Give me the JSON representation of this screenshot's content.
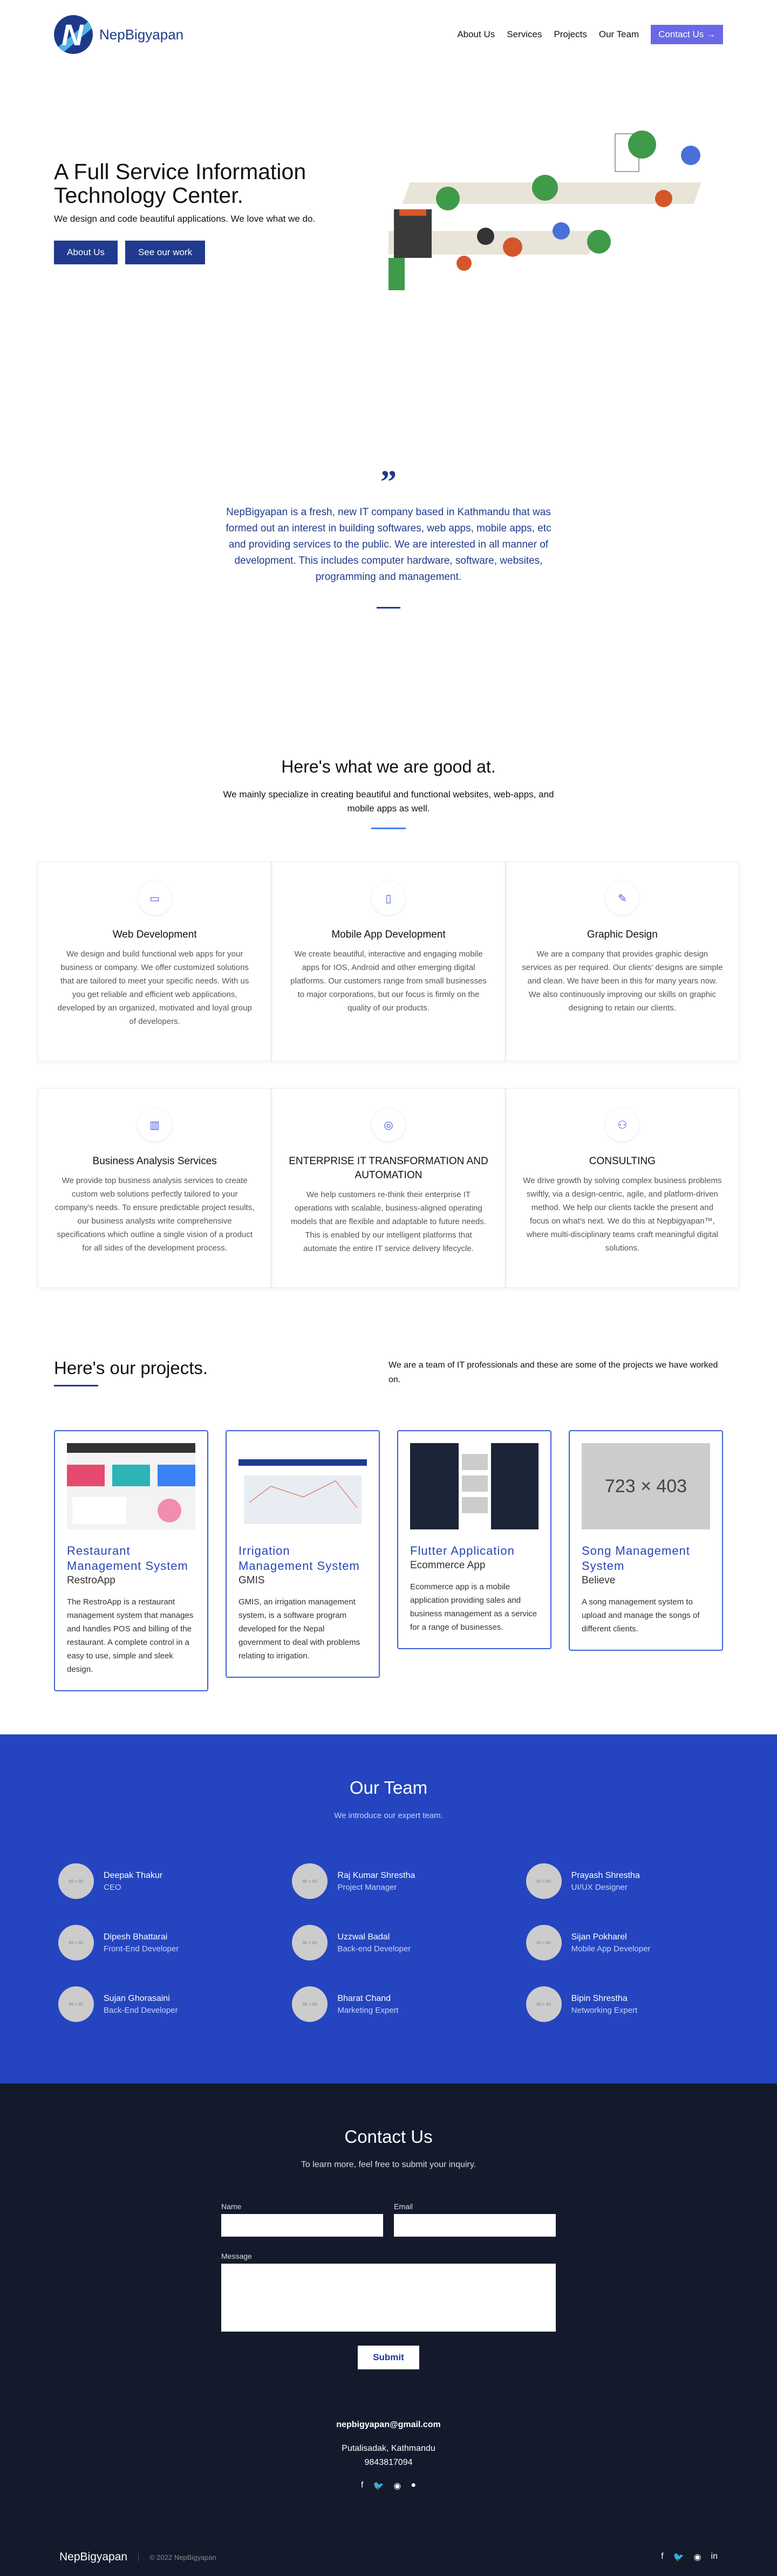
{
  "brand": {
    "name": "NepBigyapan",
    "logo_letter": "N"
  },
  "nav": {
    "links": [
      "About Us",
      "Services",
      "Projects",
      "Our Team"
    ],
    "cta": "Contact Us →"
  },
  "hero": {
    "title": "A Full Service Information Technology Center.",
    "subtitle": "We design and code beautiful applications. We love what we do.",
    "btn1": "About Us",
    "btn2": "See our work"
  },
  "about": {
    "quote_mark": "”",
    "text": "NepBigyapan is a fresh, new IT company based in Kathmandu that was formed out an interest in building softwares, web apps, mobile apps, etc and providing services to the public. We are interested in all manner of development. This includes computer hardware, software, websites, programming and management."
  },
  "services": {
    "title": "Here's what we are good at.",
    "subtitle": "We mainly specialize in creating beautiful and functional websites, web-apps, and mobile apps as well.",
    "items": [
      {
        "icon": "monitor-icon",
        "glyph": "▭",
        "title": "Web Development",
        "text": "We design and build functional web apps for your business or company. We offer customized solutions that are tailored to meet your specific needs. With us you get reliable and efficient web applications, developed by an organized, motivated and loyal group of developers."
      },
      {
        "icon": "mobile-icon",
        "glyph": "▯",
        "title": "Mobile App Development",
        "text": "We create beautiful, interactive and engaging mobile apps for IOS, Android and other emerging digital platforms. Our customers range from small businesses to major corporations, but our focus is firmly on the quality of our products."
      },
      {
        "icon": "edit-icon",
        "glyph": "✎",
        "title": "Graphic Design",
        "text": "We are a company that provides graphic design services as per required. Our clients' designs are simple and clean. We have been in this for many years now. We also continuously improving our skills on graphic designing to retain our clients."
      },
      {
        "icon": "chart-icon",
        "glyph": "▥",
        "title": "Business Analysis Services",
        "text": "We provide top business analysis services to create custom web solutions perfectly tailored to your company's needs. To ensure predictable project results, our business analysts write comprehensive specifications which outline a single vision of a product for all sides of the development process."
      },
      {
        "icon": "target-icon",
        "glyph": "◎",
        "title": "ENTERPRISE IT TRANSFORMATION AND AUTOMATION",
        "text": "We help customers re-think their enterprise IT operations with scalable, business-aligned operating models that are flexible and adaptable to future needs. This is enabled by our intelligent platforms that automate the entire IT service delivery lifecycle."
      },
      {
        "icon": "team-icon",
        "glyph": "⚇",
        "title": "CONSULTING",
        "text": "We drive growth by solving complex business problems swiftly, via a design-centric, agile, and platform-driven method. We help our clients tackle the present and focus on what's next. We do this at Nepbigyapan™, where multi-disciplinary teams craft meaningful digital solutions."
      }
    ]
  },
  "projects": {
    "title": "Here's our projects.",
    "intro": "We are a team of IT professionals and these are some of the projects we have worked on.",
    "items": [
      {
        "title": "Restaurant Management System",
        "sub": "RestroApp",
        "text": "The RestroApp is a restaurant management system that manages and handles POS and billing of the restaurant. A complete control in a easy to use, simple and sleek design.",
        "thumb": ""
      },
      {
        "title": "Irrigation Management System",
        "sub": "GMIS",
        "text": "GMIS, an irrigation management system, is a software program developed for the Nepal government to deal with problems relating to irrigation.",
        "thumb": ""
      },
      {
        "title": "Flutter Application",
        "sub": "Ecommerce App",
        "text": "Ecommerce app is a mobile application providing sales and business management as a service for a range of businesses.",
        "thumb": ""
      },
      {
        "title": "Song Management System",
        "sub": "Believe",
        "text": "A song management system to upload and manage the songs of different clients.",
        "thumb": "723 × 403"
      }
    ]
  },
  "team": {
    "title": "Our Team",
    "subtitle": "We introduce our expert team.",
    "avatar_text": "80 × 80",
    "members": [
      {
        "name": "Deepak Thakur",
        "role": "CEO"
      },
      {
        "name": "Raj Kumar Shrestha",
        "role": "Project Manager"
      },
      {
        "name": "Prayash Shrestha",
        "role": "UI/UX Designer"
      },
      {
        "name": "Dipesh Bhattarai",
        "role": "Front-End Developer"
      },
      {
        "name": "Uzzwal Badal",
        "role": "Back-end Developer"
      },
      {
        "name": "Sijan Pokharel",
        "role": "Mobile App Developer"
      },
      {
        "name": "Sujan Ghorasaini",
        "role": "Back-End Developer"
      },
      {
        "name": "Bharat Chand",
        "role": "Marketing Expert"
      },
      {
        "name": "Bipin Shrestha",
        "role": "Networking Expert"
      }
    ]
  },
  "contact": {
    "title": "Contact Us",
    "subtitle": "To learn more, feel free to submit your inquiry.",
    "name_label": "Name",
    "email_label": "Email",
    "message_label": "Message",
    "submit": "Submit",
    "email": "nepbigyapan@gmail.com",
    "address": "Putalisadak, Kathmandu",
    "phone": "9843817094",
    "socials": [
      {
        "icon": "facebook-icon",
        "glyph": "f"
      },
      {
        "icon": "twitter-icon",
        "glyph": "🐦"
      },
      {
        "icon": "instagram-icon",
        "glyph": "◉"
      },
      {
        "icon": "chat-icon",
        "glyph": "●"
      }
    ]
  },
  "footer": {
    "brand": "NepBigyapan",
    "copyright": "© 2022 NepBigyapan",
    "socials": [
      {
        "icon": "facebook-icon",
        "glyph": "f"
      },
      {
        "icon": "twitter-icon",
        "glyph": "🐦"
      },
      {
        "icon": "instagram-icon",
        "glyph": "◉"
      },
      {
        "icon": "linkedin-icon",
        "glyph": "in"
      }
    ]
  }
}
